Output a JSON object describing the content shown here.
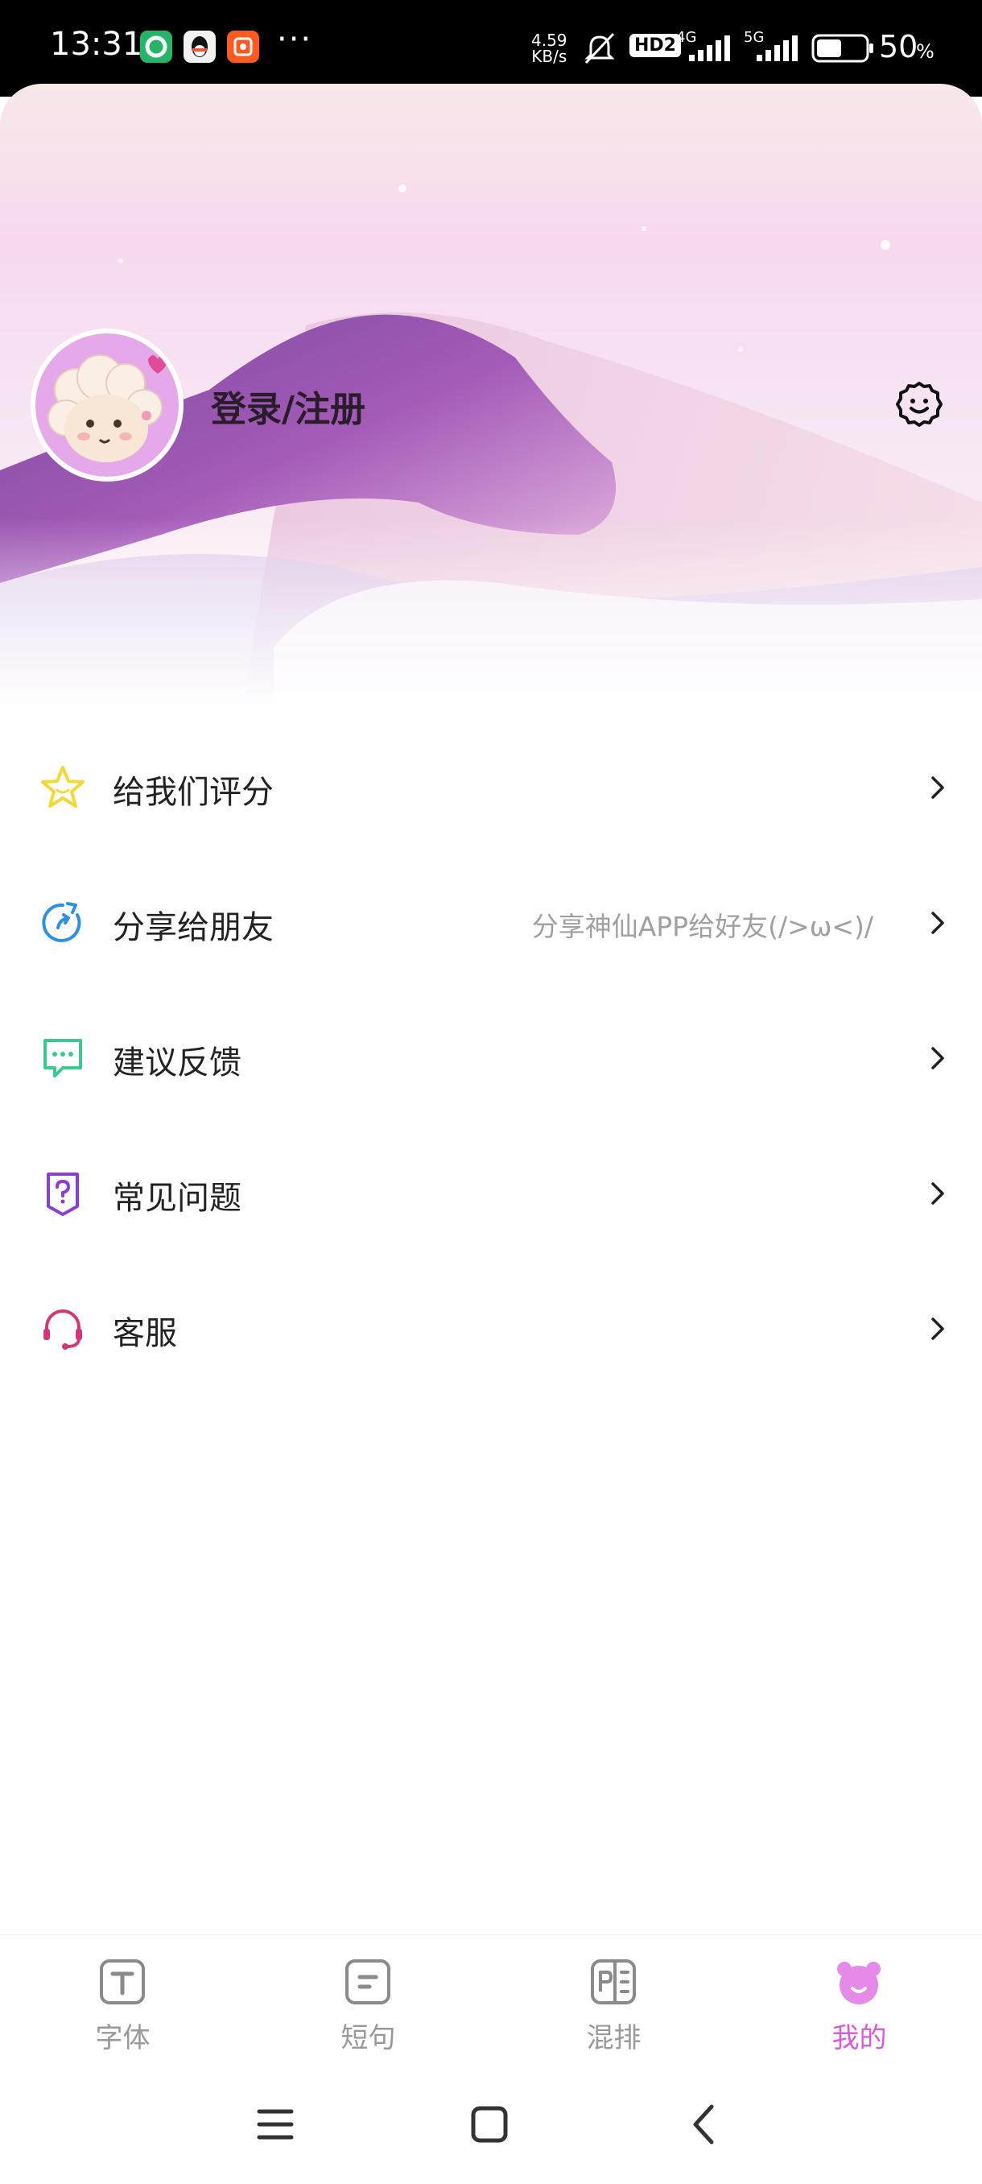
{
  "status_bar": {
    "time": "13:31",
    "speed_value": "4.59",
    "speed_unit": "KB/s",
    "hd_badge": "HD2",
    "network_4g": "4G",
    "network_5g": "5G",
    "battery": "50",
    "battery_unit": "%",
    "app_icons": [
      "green-app-icon",
      "qq-icon",
      "orange-app-icon"
    ],
    "more": "···"
  },
  "header": {
    "login_text": "登录/注册",
    "settings_icon": "settings-icon"
  },
  "menu": [
    {
      "label": "给我们评分",
      "hint": "",
      "icon": "star-icon",
      "color": "#f2d93a"
    },
    {
      "label": "分享给朋友",
      "hint": "分享神仙APP给好友(/>ω<)/",
      "icon": "share-icon",
      "color": "#2f8fe0"
    },
    {
      "label": "建议反馈",
      "hint": "",
      "icon": "feedback-icon",
      "color": "#3cc98d"
    },
    {
      "label": "常见问题",
      "hint": "",
      "icon": "faq-icon",
      "color": "#8a3fd1"
    },
    {
      "label": "客服",
      "hint": "",
      "icon": "headset-icon",
      "color": "#d2377a"
    }
  ],
  "bottom_nav": {
    "tabs": [
      {
        "label": "字体",
        "icon": "font-icon",
        "active": false
      },
      {
        "label": "短句",
        "icon": "sentence-icon",
        "active": false
      },
      {
        "label": "混排",
        "icon": "layout-icon",
        "active": false
      },
      {
        "label": "我的",
        "icon": "bear-icon",
        "active": true
      }
    ],
    "active_color": "#d75ad8",
    "inactive_color": "#999999"
  },
  "system_nav": [
    "menu-icon",
    "home-icon",
    "back-icon"
  ]
}
